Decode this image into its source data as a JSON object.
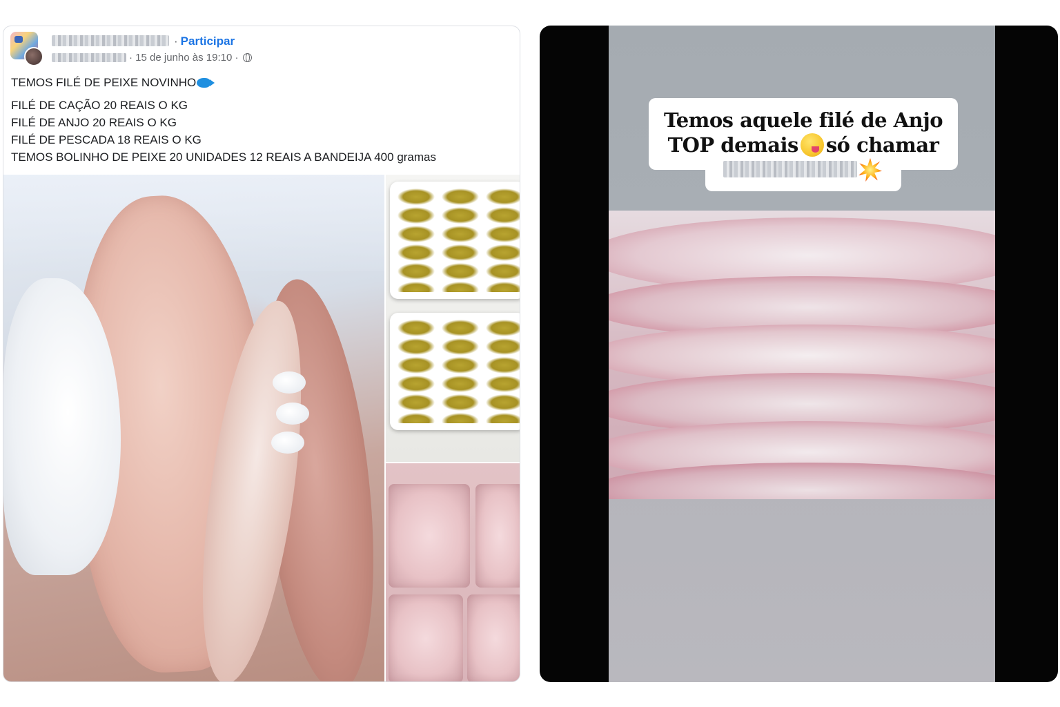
{
  "facebook_post": {
    "join_separator": "·",
    "join_label": "Participar",
    "timestamp": "15 de junho às 19:10",
    "meta_separator": "·",
    "privacy_icon": "globe-icon",
    "headline": "TEMOS FILÉ DE PEIXE NOVINHO",
    "headline_emoji": "fish-emoji",
    "lines": [
      "FILÉ DE CAÇÃO 20 REAIS O KG",
      "FILÉ DE ANJO 20 REAIS O KG",
      "FILÉ DE PESCADA 18 REAIS O KG",
      "TEMOS BOLINHO DE PEIXE 20 UNIDADES 12 REAIS A BANDEIJA 400 gramas"
    ],
    "accent_color": "#1b74e4"
  },
  "story": {
    "caption_line_1": "Temos aquele filé de Anjo",
    "caption_line_2_start": "TOP demais",
    "caption_emoji": "yum-emoji",
    "caption_line_2_end": "só chamar",
    "trailing_emoji": "boom-emoji"
  }
}
